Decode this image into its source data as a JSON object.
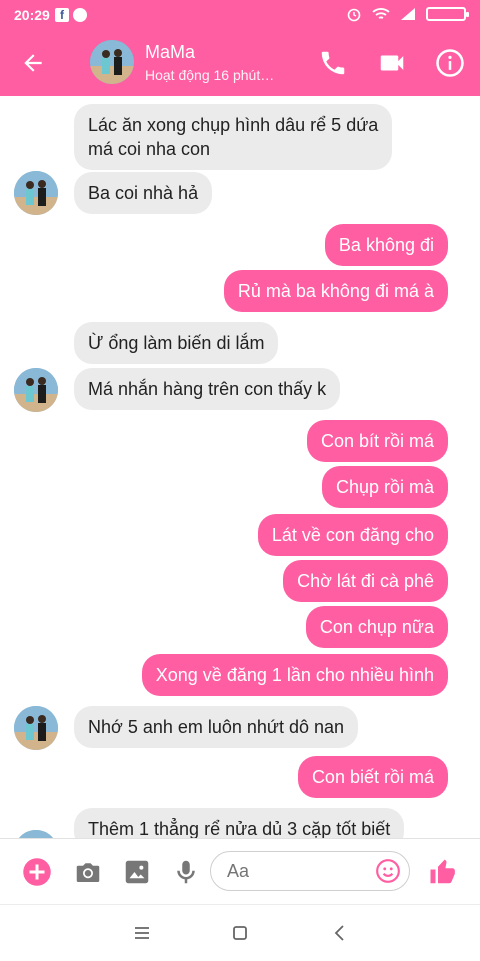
{
  "status_bar": {
    "time": "20:29"
  },
  "header": {
    "contact_name": "MaMa",
    "activity": "Hoạt động 16 phút…"
  },
  "messages": [
    {
      "dir": "in",
      "text_lines": [
        "Lác ăn xong chụp hình dâu rể 5 dứa",
        "má coi nha con"
      ]
    },
    {
      "dir": "in",
      "text_lines": [
        "Ba coi nhà hả"
      ]
    },
    {
      "dir": "out",
      "text_lines": [
        "Ba không đi"
      ]
    },
    {
      "dir": "out",
      "text_lines": [
        "Rủ mà ba không đi má à"
      ]
    },
    {
      "dir": "in",
      "text_lines": [
        "Ừ  ổng làm biến di lắm"
      ]
    },
    {
      "dir": "in",
      "text_lines": [
        "Má nhắn hàng trên con thấy k"
      ]
    },
    {
      "dir": "out",
      "text_lines": [
        "Con bít rồi má"
      ]
    },
    {
      "dir": "out",
      "text_lines": [
        "Chụp rồi mà"
      ]
    },
    {
      "dir": "out",
      "text_lines": [
        "Lát về con đăng cho"
      ]
    },
    {
      "dir": "out",
      "text_lines": [
        "Chờ lát đi cà phê"
      ]
    },
    {
      "dir": "out",
      "text_lines": [
        "Con chụp nữa"
      ]
    },
    {
      "dir": "out",
      "text_lines": [
        "Xong về đăng 1 lần cho nhiều hình"
      ]
    },
    {
      "dir": "in",
      "text_lines": [
        "Nhớ 5 anh em luôn nhứt dô nan"
      ]
    },
    {
      "dir": "out",
      "text_lines": [
        "Con biết rồi má"
      ]
    },
    {
      "dir": "in",
      "text_lines": [
        "Thêm 1 thẳng rể nửa dủ 3 cặp tốt biết"
      ]
    }
  ],
  "composer": {
    "placeholder": "Aa"
  },
  "icons": {
    "back": "arrow-left",
    "call": "phone",
    "video": "video-camera",
    "info": "info-circle",
    "add": "plus-circle",
    "camera": "camera",
    "image": "image",
    "mic": "microphone",
    "emoji": "smiley",
    "like": "thumbs-up"
  },
  "colors": {
    "accent": "#ff5fa2",
    "incoming_bubble": "#ebebeb"
  }
}
